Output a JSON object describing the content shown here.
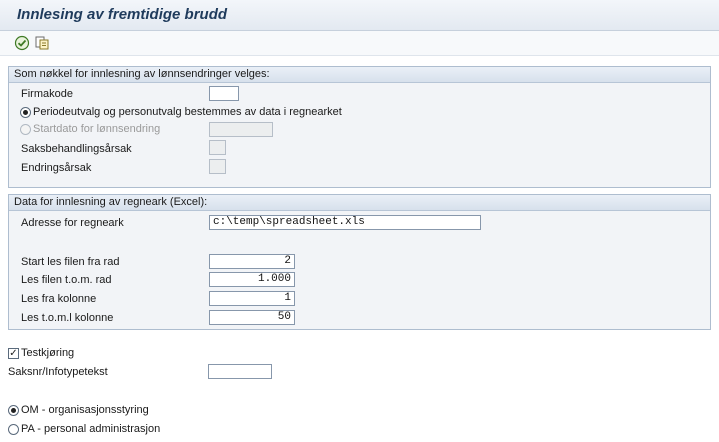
{
  "header": {
    "title": "Innlesing av fremtidige brudd"
  },
  "toolbar": {
    "execute_icon": "execute-icon",
    "variant_icon": "variant-icon"
  },
  "group_key": {
    "title": "Som nøkkel for innlesning av lønnsendringer velges:",
    "firmakode_label": "Firmakode",
    "firmakode_value": "",
    "radio_period_label": "Periodeutvalg og personutvalg bestemmes av data i regnearket",
    "radio_period_selected": true,
    "radio_startdate_label": "Startdato for lønnsendring",
    "radio_startdate_selected": false,
    "startdate_value": "",
    "reason_label": "Saksbehandlingsårsak",
    "reason_value": "",
    "change_reason_label": "Endringsårsak",
    "change_reason_value": ""
  },
  "group_excel": {
    "title": "Data for innlesning av regneark (Excel):",
    "address_label": "Adresse for regneark",
    "address_value": "c:\\temp\\spreadsheet.xls",
    "start_row_label": "Start les filen fra rad",
    "start_row_value": "2",
    "end_row_label": "Les filen t.o.m. rad",
    "end_row_value": "1.000",
    "from_col_label": "Les fra kolonne",
    "from_col_value": "1",
    "to_col_label": "Les t.o.m.l kolonne",
    "to_col_value": "50"
  },
  "options": {
    "test_run_label": "Testkjøring",
    "test_run_checked": true,
    "case_label": "Saksnr/Infotypetekst",
    "case_value": "",
    "om_label": "OM - organisasjonsstyring",
    "om_selected": true,
    "pa_label": "PA - personal administrasjon",
    "pa_selected": false
  }
}
